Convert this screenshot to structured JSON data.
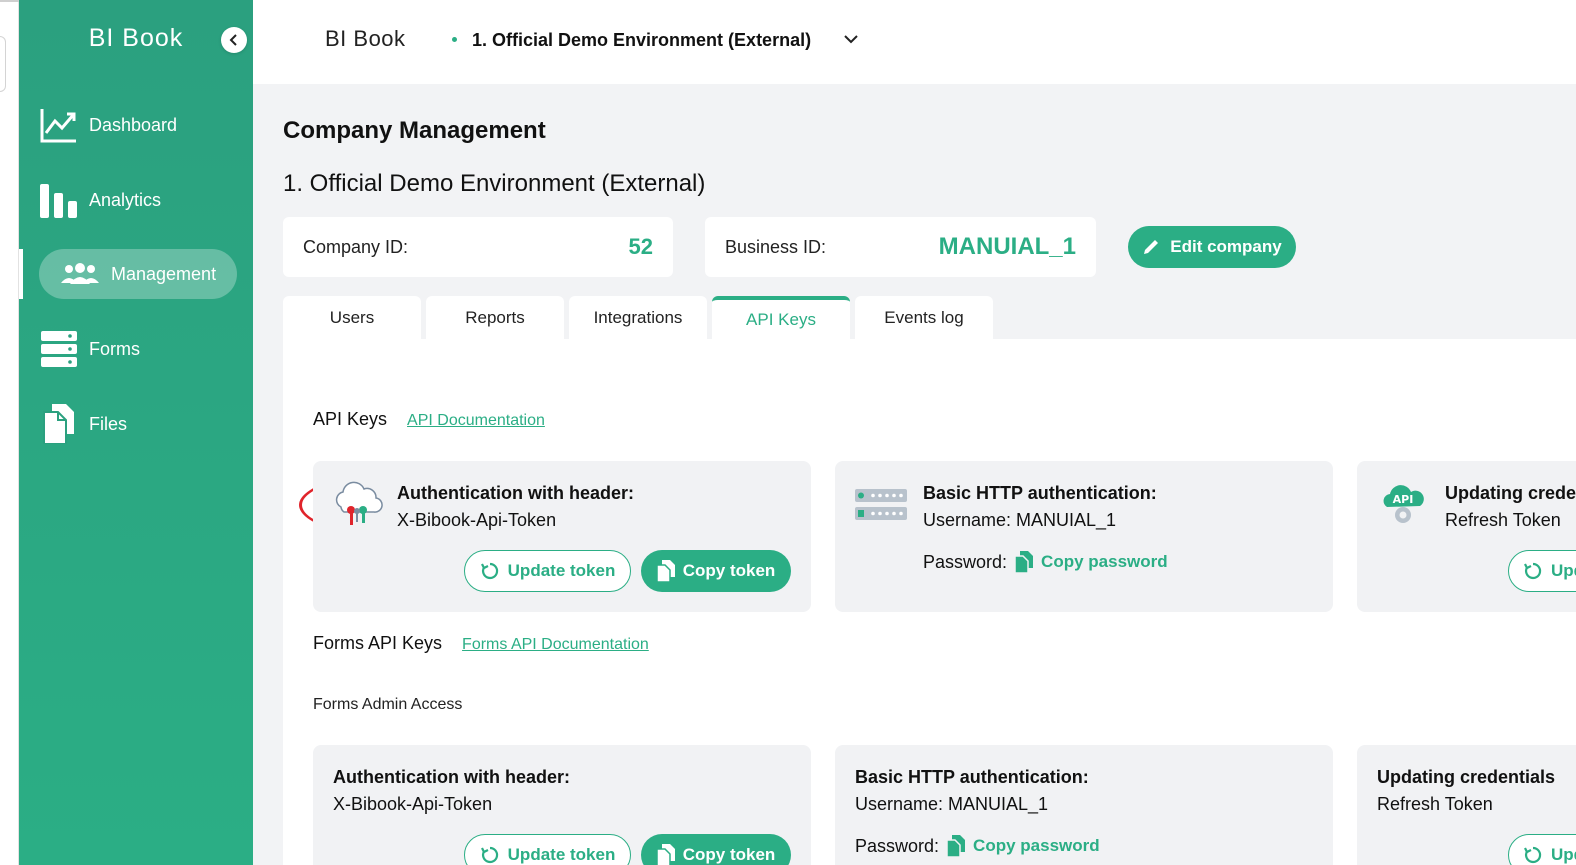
{
  "app": {
    "brand": "BI Book"
  },
  "sidebar": {
    "items": [
      {
        "label": "Dashboard",
        "icon": "chart-line-icon"
      },
      {
        "label": "Analytics",
        "icon": "bar-chart-icon"
      },
      {
        "label": "Management",
        "icon": "users-icon",
        "active": true
      },
      {
        "label": "Forms",
        "icon": "server-stack-icon"
      },
      {
        "label": "Files",
        "icon": "files-icon"
      }
    ]
  },
  "topbar": {
    "app_name": "BI Book",
    "environment": "1. Official Demo Environment (External)"
  },
  "page": {
    "title": "Company Management",
    "company_name": "1. Official Demo Environment (External)",
    "company_id_label": "Company ID:",
    "company_id": "52",
    "business_id_label": "Business ID:",
    "business_id": "MANUIAL_1",
    "edit_label": "Edit company"
  },
  "tabs": [
    {
      "label": "Users"
    },
    {
      "label": "Reports"
    },
    {
      "label": "Integrations"
    },
    {
      "label": "API Keys",
      "active": true
    },
    {
      "label": "Events log"
    }
  ],
  "api_section": {
    "title": "API Keys",
    "doc_link": "API Documentation",
    "cards": {
      "header": {
        "title": "Authentication with header:",
        "value": "X-Bibook-Api-Token",
        "update": "Update token",
        "copy": "Copy token"
      },
      "basic": {
        "title": "Basic HTTP authentication:",
        "username": "Username: MANUIAL_1",
        "password_label": "Password:",
        "copy_password": "Copy password"
      },
      "update": {
        "title": "Updating credentials",
        "value": "Refresh Token",
        "button": "Update"
      }
    }
  },
  "forms_section": {
    "title": "Forms API Keys",
    "doc_link": "Forms API Documentation",
    "subtitle": "Forms Admin Access",
    "cards": {
      "header": {
        "title": "Authentication with header:",
        "value": "X-Bibook-Api-Token",
        "update": "Update token",
        "copy": "Copy token"
      },
      "basic": {
        "title": "Basic HTTP authentication:",
        "username": "Username: MANUIAL_1",
        "password_label": "Password:",
        "copy_password": "Copy password"
      },
      "update": {
        "title": "Updating credentials",
        "value": "Refresh Token",
        "button": "Update"
      }
    }
  },
  "colors": {
    "brand": "#2bae85",
    "annotation": "#e0242b"
  }
}
